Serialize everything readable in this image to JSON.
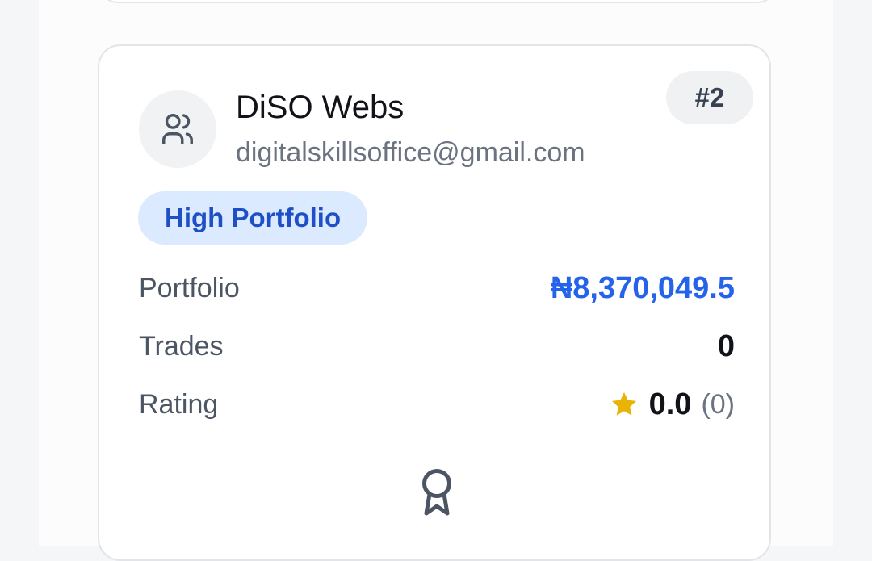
{
  "card": {
    "name": "DiSO Webs",
    "email": "digitalskillsoffice@gmail.com",
    "rank": "#2",
    "badge": "High Portfolio",
    "stats": {
      "portfolio_label": "Portfolio",
      "portfolio_value": "₦8,370,049.5",
      "trades_label": "Trades",
      "trades_value": "0",
      "rating_label": "Rating",
      "rating_value": "0.0",
      "rating_count": "(0)"
    }
  },
  "icons": {
    "avatar": "users-icon",
    "rating": "star-icon",
    "footer": "award-icon"
  },
  "colors": {
    "accent": "#2563eb",
    "badge_bg": "#dbeafe",
    "badge_text": "#1e4fc7",
    "star": "#eab308"
  }
}
